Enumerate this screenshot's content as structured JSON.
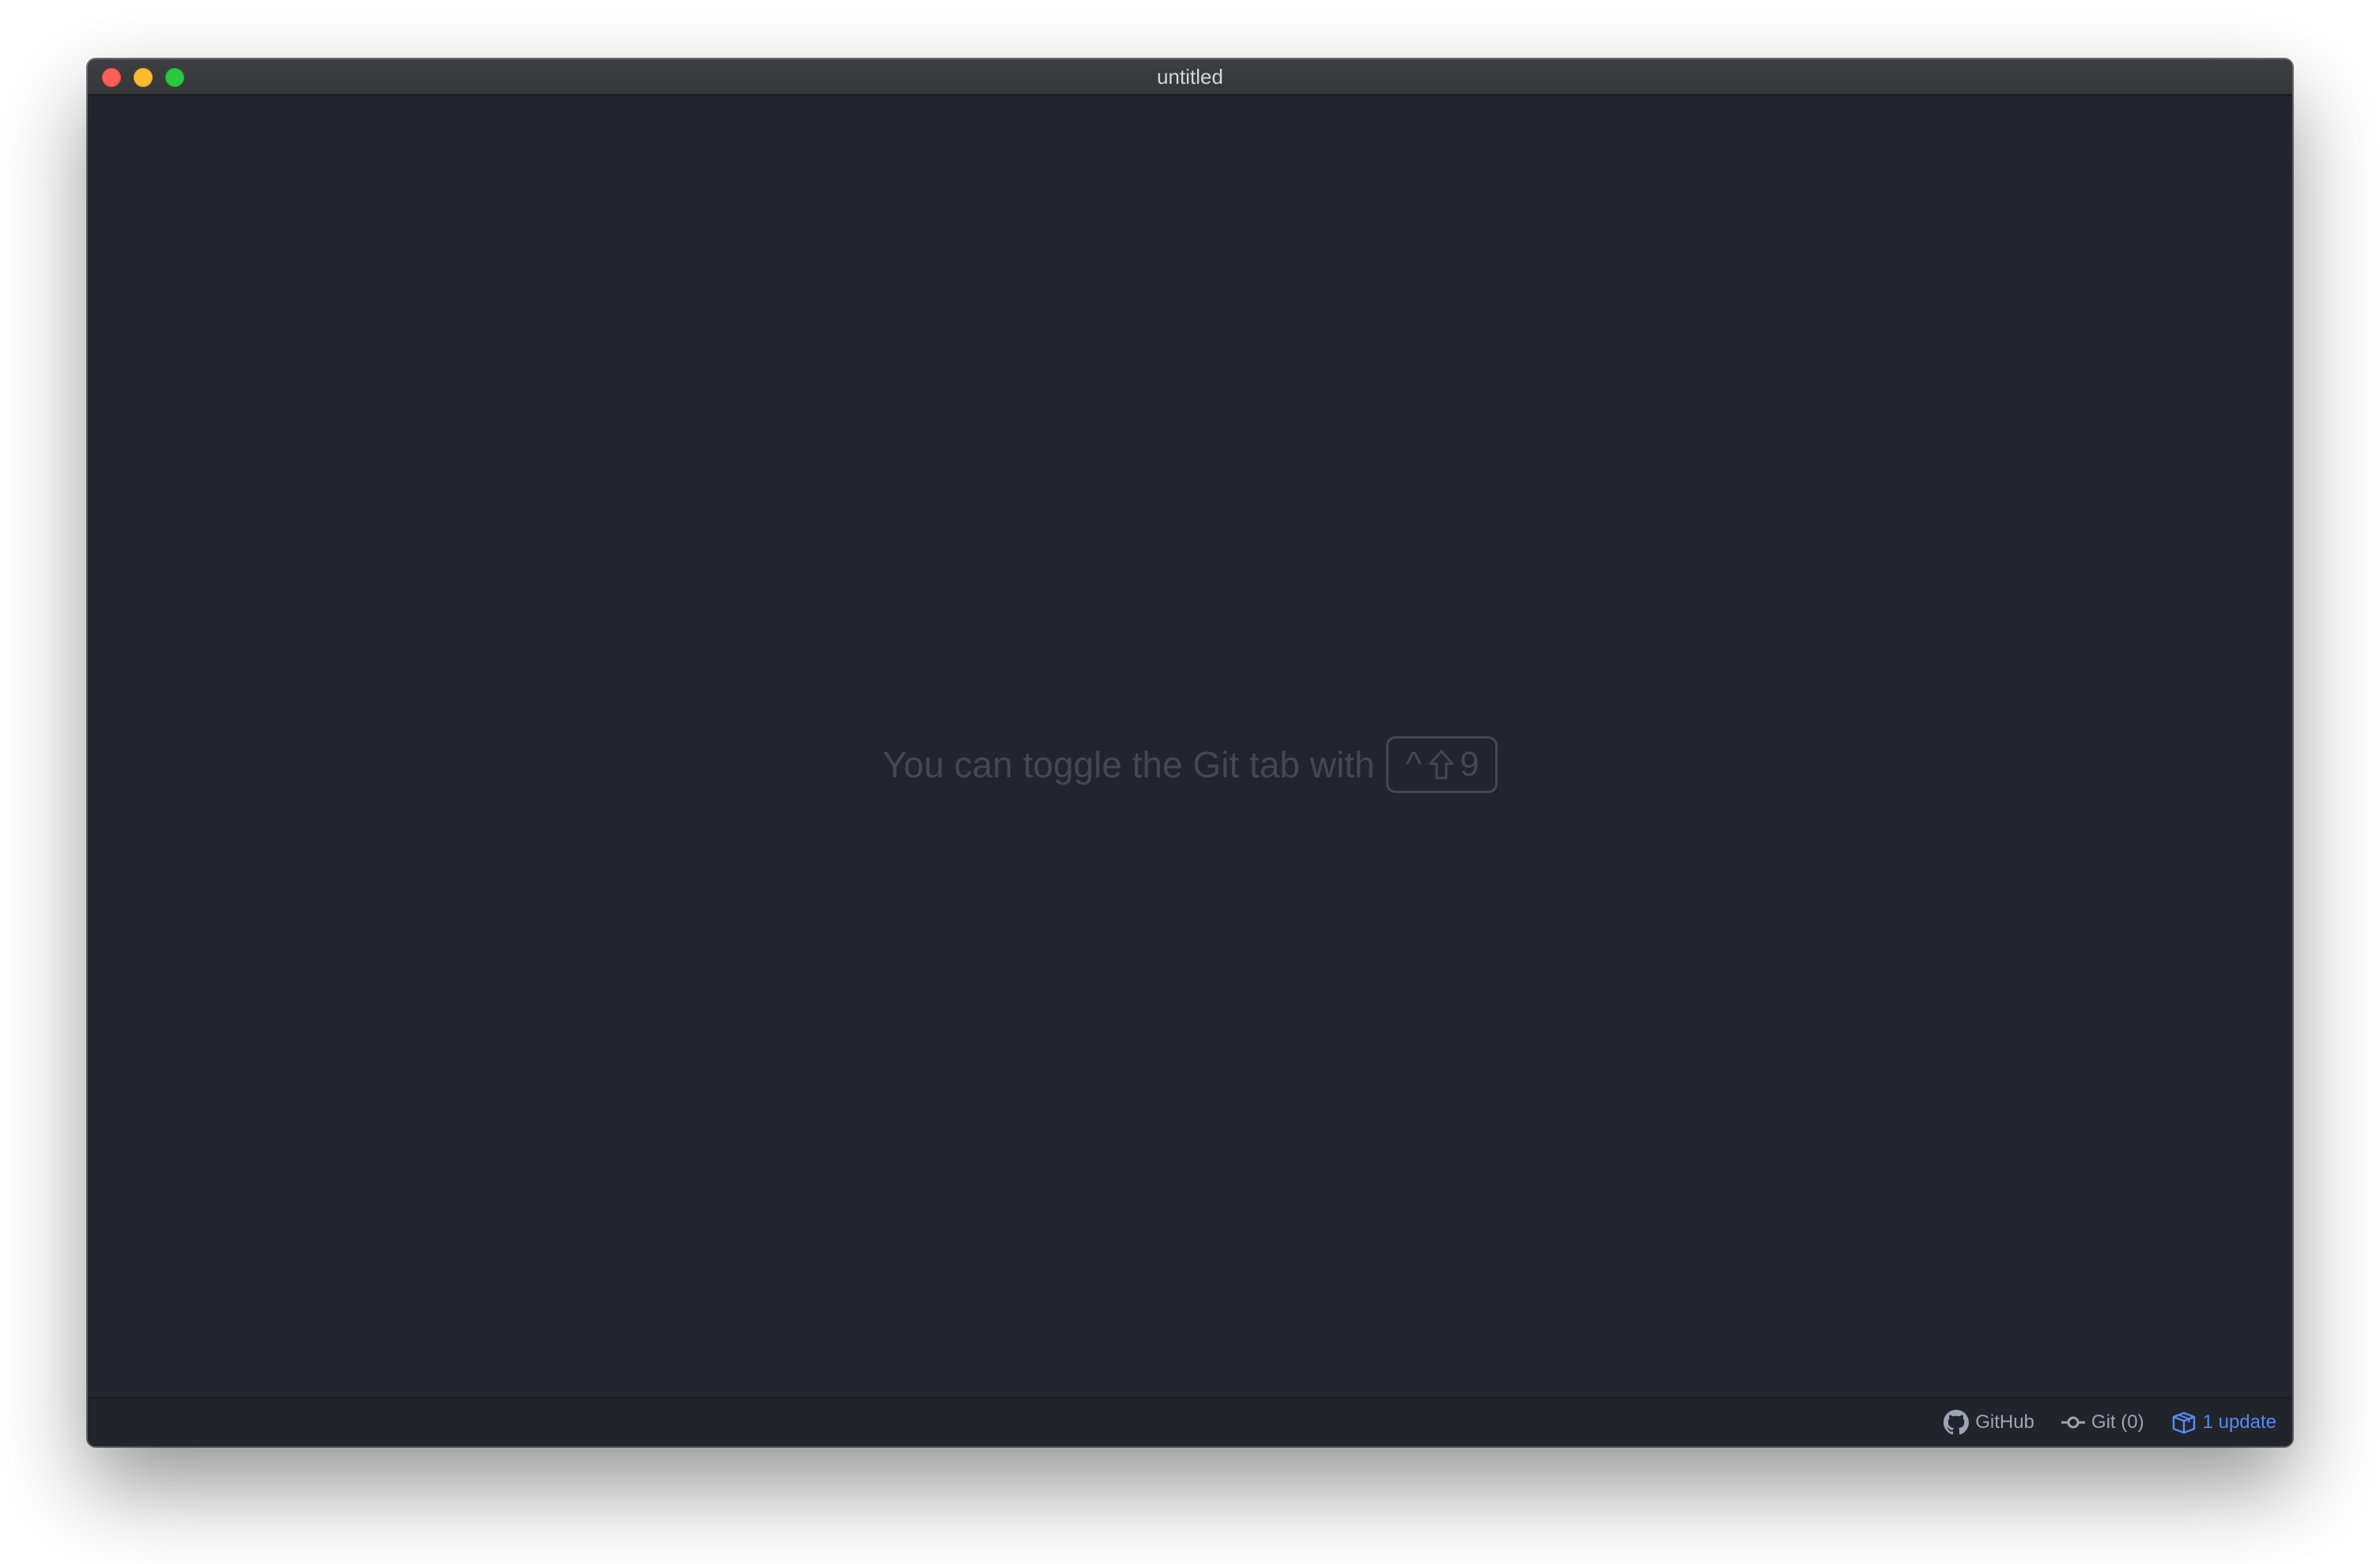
{
  "window": {
    "title": "untitled"
  },
  "workspace": {
    "hint_text": "You can toggle the Git tab with",
    "keybinding": {
      "ctrl_symbol": "^",
      "shift_icon": "shift-arrow-icon",
      "key": "9"
    }
  },
  "statusbar": {
    "github_label": "GitHub",
    "github_icon": "github-mark-icon",
    "git_label": "Git (0)",
    "git_icon": "git-commit-icon",
    "update_label": "1 update",
    "update_icon": "package-icon"
  },
  "colors": {
    "background": "#22252d",
    "titlebar": "#38393c",
    "hint_text": "#444851",
    "status_text": "#9da5b4",
    "update_accent": "#568af2",
    "close": "#fe5f57",
    "minimize": "#febc2e",
    "zoom": "#28c840"
  }
}
